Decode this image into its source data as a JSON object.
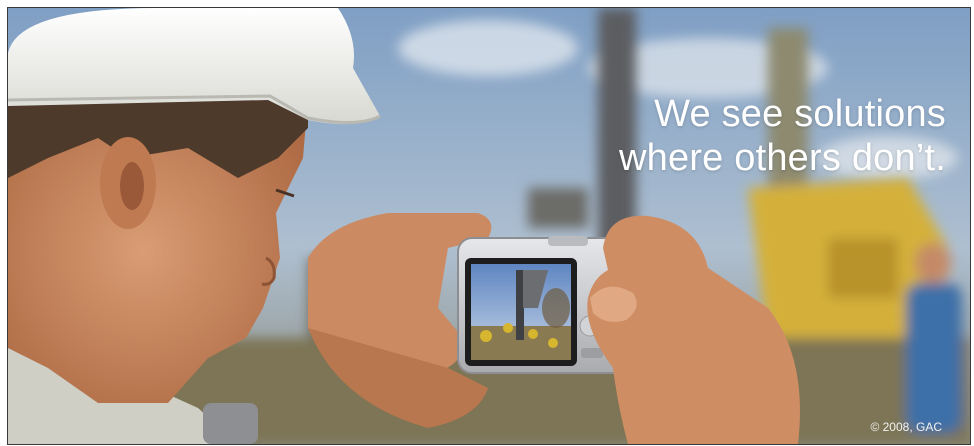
{
  "banner": {
    "headline_line1": "We see solutions",
    "headline_line2": "where others don’t.",
    "copyright": "© 2008, GAC"
  },
  "colors": {
    "sky": "#9fb3c8",
    "hard_hat": "#f3f3ef",
    "skin": "#c98a63",
    "camera": "#c9cbcf",
    "machinery_yellow": "#d9b43a"
  }
}
